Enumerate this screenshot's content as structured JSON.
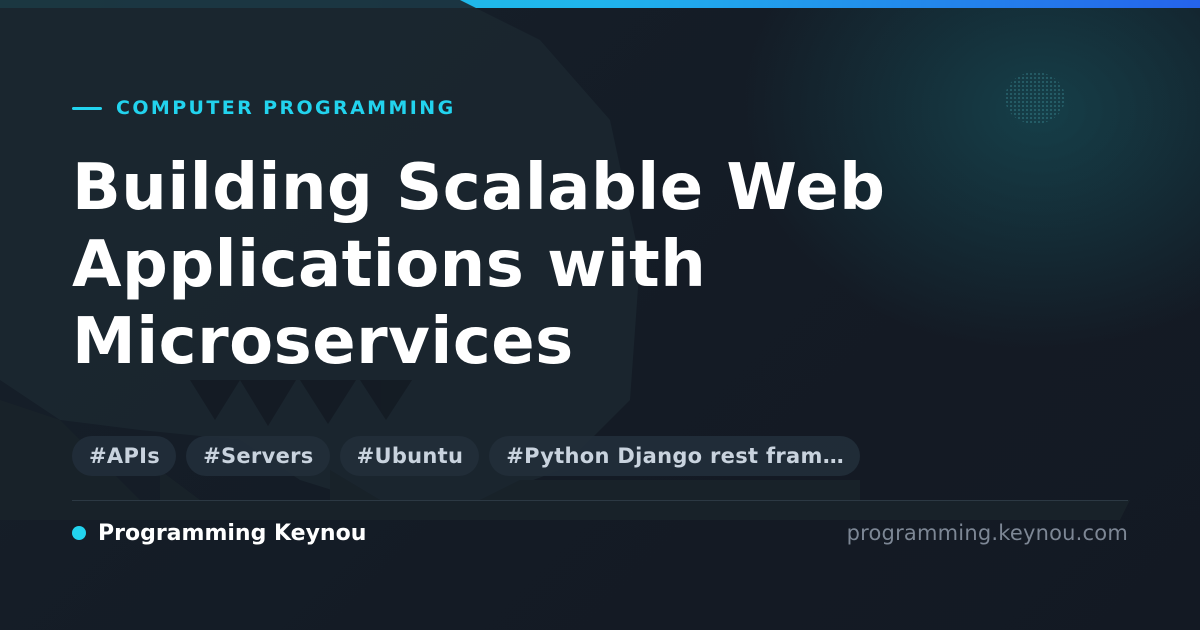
{
  "header": {
    "category": "COMPUTER PROGRAMMING"
  },
  "article": {
    "title": "Building Scalable Web Applications with Microservices"
  },
  "tags": [
    {
      "label": "#APIs"
    },
    {
      "label": "#Servers"
    },
    {
      "label": "#Ubuntu"
    },
    {
      "label": "#Python Django rest fram…"
    }
  ],
  "footer": {
    "brand": "Programming Keynou",
    "domain": "programming.keynou.com"
  },
  "colors": {
    "accent": "#22d3ee",
    "background": "#141b24",
    "title": "#ffffff",
    "tag_bg": "#222e3a",
    "tag_text": "#c9d3de",
    "domain_text": "#7d8795"
  }
}
